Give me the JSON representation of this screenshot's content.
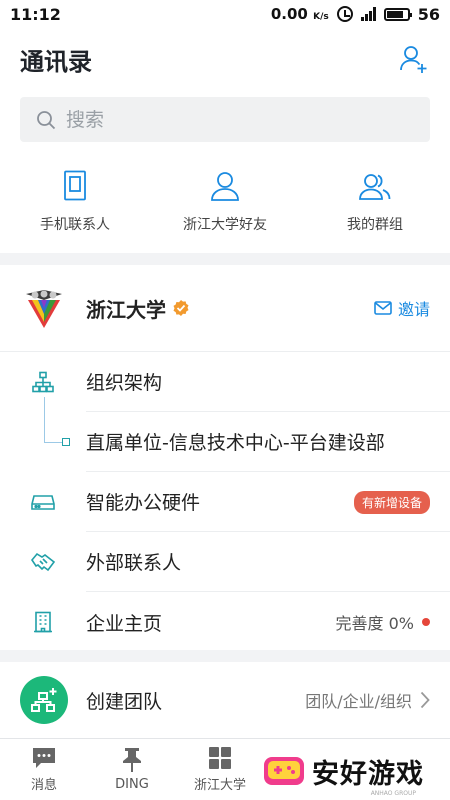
{
  "status_bar": {
    "time": "11:12",
    "net_speed": "0.00",
    "net_unit": "K/s",
    "battery": "56"
  },
  "header": {
    "title": "通讯录"
  },
  "search": {
    "placeholder": "搜索"
  },
  "quick_entries": [
    {
      "label": "手机联系人",
      "icon": "phone-contacts-icon"
    },
    {
      "label": "浙江大学好友",
      "icon": "person-icon"
    },
    {
      "label": "我的群组",
      "icon": "group-icon"
    }
  ],
  "organization": {
    "name": "浙江大学",
    "verified": true,
    "invite_label": "邀请",
    "items": [
      {
        "label": "组织架构",
        "icon": "org-chart-icon"
      },
      {
        "label": "直属单位-信息技术中心-平台建设部",
        "icon": "tree-node-icon"
      },
      {
        "label": "智能办公硬件",
        "icon": "hardware-icon",
        "badge": "有新增设备"
      },
      {
        "label": "外部联系人",
        "icon": "handshake-icon"
      },
      {
        "label": "企业主页",
        "icon": "building-icon",
        "trail": "完善度 0%"
      }
    ]
  },
  "create_team": {
    "title": "创建团队",
    "subtitle": "团队/企业/组织"
  },
  "tabs": [
    {
      "label": "消息",
      "icon": "message-icon"
    },
    {
      "label": "DING",
      "icon": "pin-icon"
    },
    {
      "label": "浙江大学",
      "icon": "grid-icon"
    }
  ],
  "watermark": {
    "text": "安好游戏",
    "small": "ANHAO GROUP"
  },
  "colors": {
    "accent": "#1a8ae0",
    "icon_teal": "#21a0a8",
    "green": "#1cb87a",
    "badge_red": "#e5604d"
  }
}
